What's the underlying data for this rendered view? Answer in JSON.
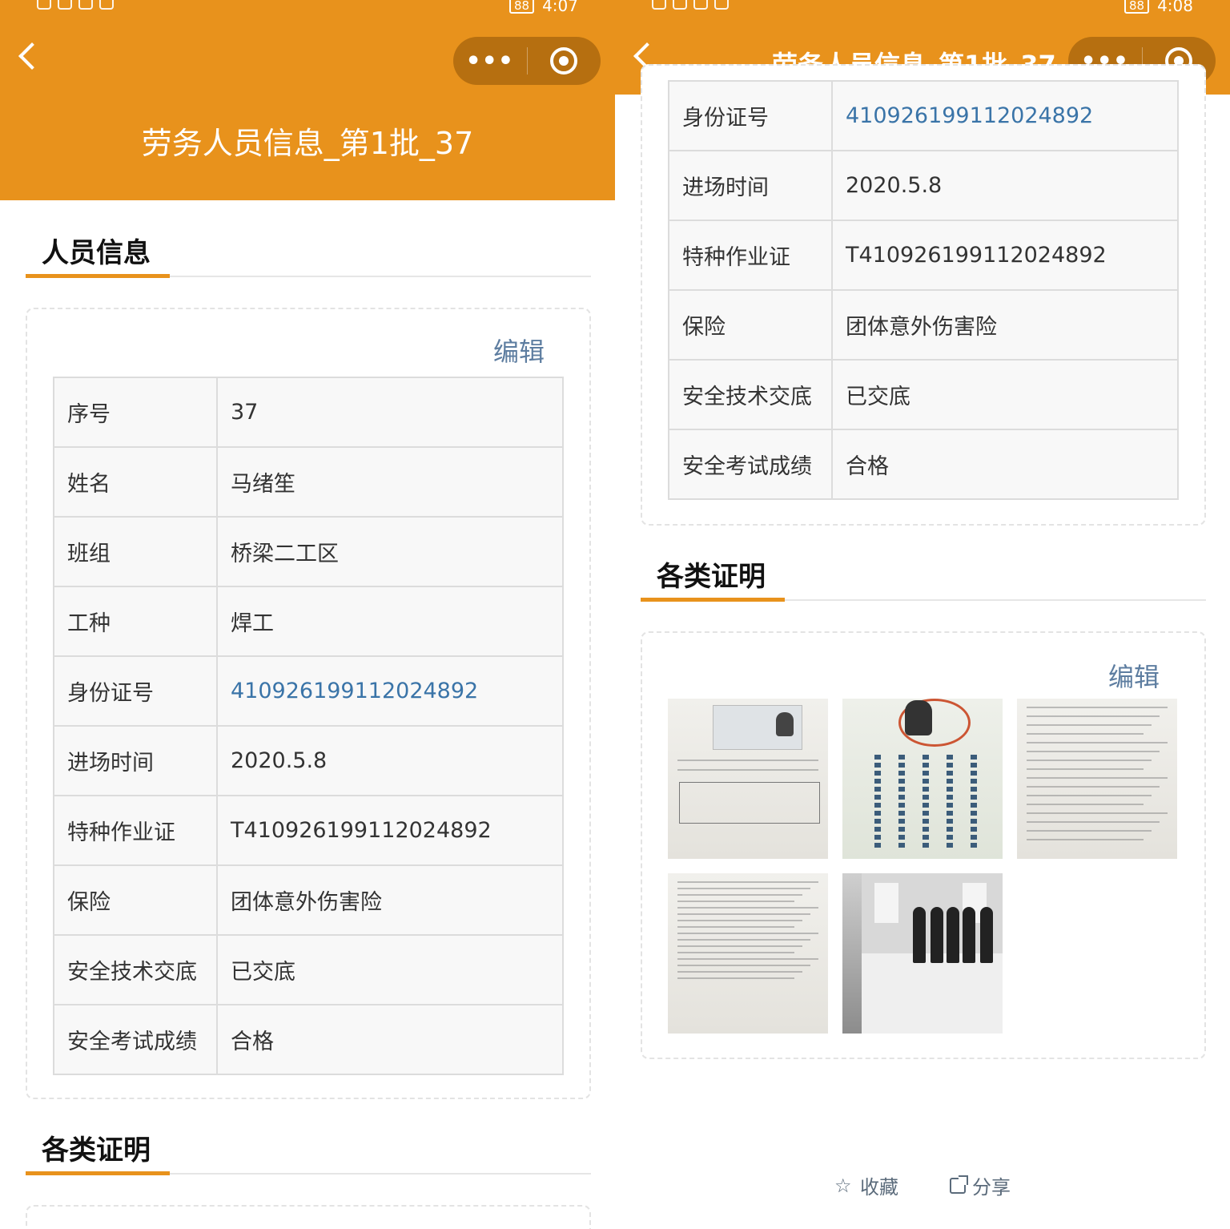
{
  "left": {
    "statusbar": {
      "time": "4:07",
      "battery": "88"
    },
    "nav": {
      "title": ""
    },
    "hero_title": "劳务人员信息_第1批_37",
    "section_person": "人员信息",
    "edit_label": "编辑",
    "rows": [
      {
        "k": "序号",
        "v": "37"
      },
      {
        "k": "姓名",
        "v": "马绪笙"
      },
      {
        "k": "班组",
        "v": "桥梁二工区"
      },
      {
        "k": "工种",
        "v": "焊工"
      },
      {
        "k": "身份证号",
        "v": "410926199112024892"
      },
      {
        "k": "进场时间",
        "v": "2020.5.8"
      },
      {
        "k": "特种作业证",
        "v": "T410926199112024892"
      },
      {
        "k": "保险",
        "v": "团体意外伤害险"
      },
      {
        "k": "安全技术交底",
        "v": "已交底"
      },
      {
        "k": "安全考试成绩",
        "v": "合格"
      }
    ],
    "section_docs": "各类证明"
  },
  "right": {
    "statusbar": {
      "time": "4:08",
      "battery": "88"
    },
    "nav": {
      "title": "劳务人员信息_第1批_37"
    },
    "rows": [
      {
        "k": "身份证号",
        "v": "410926199112024892"
      },
      {
        "k": "进场时间",
        "v": "2020.5.8"
      },
      {
        "k": "特种作业证",
        "v": "T410926199112024892"
      },
      {
        "k": "保险",
        "v": "团体意外伤害险"
      },
      {
        "k": "安全技术交底",
        "v": "已交底"
      },
      {
        "k": "安全考试成绩",
        "v": "合格"
      }
    ],
    "section_docs": "各类证明",
    "edit_label": "编辑",
    "footer": {
      "favorite": "收藏",
      "share": "分享"
    }
  },
  "colors": {
    "accent": "#e8921c",
    "link": "#3a74a8",
    "edit": "#5d7da0"
  },
  "icons": [
    "back-chevron-icon",
    "more-dots-icon",
    "record-circle-icon",
    "star-icon",
    "share-icon"
  ]
}
